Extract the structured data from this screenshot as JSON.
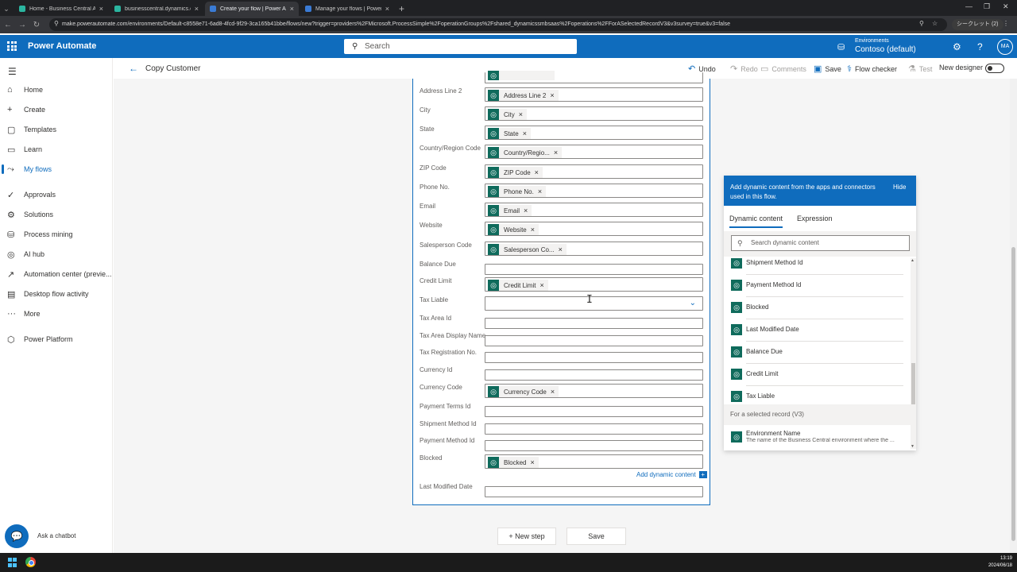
{
  "browser": {
    "tabs": [
      {
        "title": "Home - Business Central Admin",
        "favicon_color": "#2bb5a0",
        "active": false
      },
      {
        "title": "businesscentral.dynamics.com/",
        "favicon_color": "#2bb5a0",
        "active": false
      },
      {
        "title": "Create your flow | Power Automate",
        "favicon_color": "#3a7bd5",
        "active": true
      },
      {
        "title": "Manage your flows | Power Automate",
        "favicon_color": "#3a7bd5",
        "active": false
      }
    ],
    "tab_close": "×",
    "new_tab": "+",
    "url": "make.powerautomate.com/environments/Default-c8558e71-6ad8-4fcd-9f29-3ca165b41bbe/flows/new?trigger=providers%2FMicrosoft.ProcessSimple%2FoperationGroups%2Fshared_dynamicssmbsaas%2Foperations%2FForASelectedRecordV3&v3survey=true&v3=false",
    "profile_label": "シークレット (2)"
  },
  "header": {
    "app_name": "Power Automate",
    "search_placeholder": "Search",
    "env_label": "Environments",
    "env_name": "Contoso (default)",
    "avatar_initials": "MA"
  },
  "sidebar": {
    "items": [
      {
        "label": "Home",
        "icon": "home-icon",
        "glyph": "⌂",
        "active": false
      },
      {
        "label": "Create",
        "icon": "plus-icon",
        "glyph": "+",
        "active": false
      },
      {
        "label": "Templates",
        "icon": "templates-icon",
        "glyph": "▢",
        "active": false
      },
      {
        "label": "Learn",
        "icon": "book-icon",
        "glyph": "▭",
        "active": false
      },
      {
        "label": "My flows",
        "icon": "flows-icon",
        "glyph": "⤳",
        "active": true
      },
      {
        "label": "Approvals",
        "icon": "approvals-icon",
        "glyph": "✓",
        "active": false
      },
      {
        "label": "Solutions",
        "icon": "solutions-icon",
        "glyph": "⚙",
        "active": false
      },
      {
        "label": "Process mining",
        "icon": "process-mining-icon",
        "glyph": "⛁",
        "active": false
      },
      {
        "label": "AI hub",
        "icon": "ai-hub-icon",
        "glyph": "◎",
        "active": false
      },
      {
        "label": "Automation center (previe...",
        "icon": "automation-center-icon",
        "glyph": "↗",
        "active": false
      },
      {
        "label": "Desktop flow activity",
        "icon": "desktop-flow-icon",
        "glyph": "▤",
        "active": false
      },
      {
        "label": "More",
        "icon": "more-icon",
        "glyph": "···",
        "active": false
      },
      {
        "label": "Power Platform",
        "icon": "power-platform-icon",
        "glyph": "⬡",
        "active": false
      }
    ],
    "chatbot_label": "Ask a chatbot"
  },
  "cmdbar": {
    "flow_name": "Copy Customer",
    "undo": "Undo",
    "redo": "Redo",
    "comments": "Comments",
    "save": "Save",
    "flow_checker": "Flow checker",
    "test": "Test",
    "new_designer": "New designer"
  },
  "form": {
    "fields": [
      {
        "label": "Address Line 2",
        "token": "Address Line 2"
      },
      {
        "label": "City",
        "token": "City"
      },
      {
        "label": "State",
        "token": "State"
      },
      {
        "label": "Country/Region Code",
        "token": "Country/Regio..."
      },
      {
        "label": "ZIP Code",
        "token": "ZIP Code"
      },
      {
        "label": "Phone No.",
        "token": "Phone No."
      },
      {
        "label": "Email",
        "token": "Email"
      },
      {
        "label": "Website",
        "token": "Website"
      },
      {
        "label": "Salesperson Code",
        "token": "Salesperson Co..."
      },
      {
        "label": "Balance Due",
        "token": ""
      },
      {
        "label": "Credit Limit",
        "token": "Credit Limit"
      },
      {
        "label": "Tax Liable",
        "token": "",
        "dropdown": true
      },
      {
        "label": "Tax Area Id",
        "token": ""
      },
      {
        "label": "Tax Area Display Name",
        "token": ""
      },
      {
        "label": "Tax Registration No.",
        "token": ""
      },
      {
        "label": "Currency Id",
        "token": ""
      },
      {
        "label": "Currency Code",
        "token": "Currency Code"
      },
      {
        "label": "Payment Terms Id",
        "token": ""
      },
      {
        "label": "Shipment Method Id",
        "token": ""
      },
      {
        "label": "Payment Method Id",
        "token": ""
      },
      {
        "label": "Blocked",
        "token": "Blocked"
      },
      {
        "label": "Last Modified Date",
        "token": ""
      }
    ],
    "add_dynamic_content": "Add dynamic content",
    "token_remove": "×"
  },
  "canvas": {
    "new_step": "+ New step",
    "save": "Save"
  },
  "dynamic_panel": {
    "description": "Add dynamic content from the apps and connectors used in this flow.",
    "hide": "Hide",
    "tab_dynamic": "Dynamic content",
    "tab_expression": "Expression",
    "search_placeholder": "Search dynamic content",
    "items": [
      "Shipment Method Id",
      "Payment Method Id",
      "Blocked",
      "Last Modified Date",
      "Balance Due",
      "Credit Limit",
      "Tax Liable"
    ],
    "section": "For a selected record (V3)",
    "env_item": "Environment Name",
    "env_item_desc": "The name of the Business Central environment where the ..."
  },
  "taskbar": {
    "time": "13:19",
    "date": "2024/06/18"
  },
  "colors": {
    "brand": "#0f6cbd",
    "token_icon": "#0f6b5c"
  }
}
